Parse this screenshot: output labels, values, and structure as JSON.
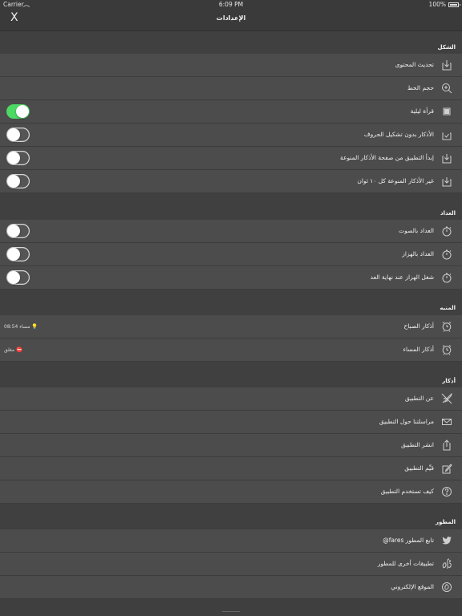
{
  "status": {
    "carrier": "Carrier",
    "time": "6:09 PM",
    "battery": "100%"
  },
  "nav": {
    "close": "X",
    "title": "الإعدادات"
  },
  "sections": {
    "shape": {
      "header": "الشكل",
      "update_content": "تحديث المحتوى",
      "font_size": "حجم الخط",
      "night_reading": "قرأة ليلية",
      "no_diacritics": "الأذكار بدون تشكيل الحروف",
      "start_varied": "إبدأ التطبيق من صفحة الأذكار المنوعة",
      "change_colors": "غير الأذكار المنوعة كل ١٠ ثوان"
    },
    "counter": {
      "header": "العداد",
      "sound": "العداد بالصوت",
      "vibration": "العداد بالهزاز",
      "vibrate_end": "شغل الهزاز عند نهاية العد"
    },
    "alarm": {
      "header": "المنبه",
      "morning": "أذكار الصباح",
      "morning_info": "08:54 مساء",
      "evening": "أذكار المساء",
      "evening_info": "مغلق"
    },
    "azkar": {
      "header": "أذكار",
      "about": "عن التطبيق",
      "contact": "مراسلتنا حول التطبيق",
      "share": "انشر التطبيق",
      "rate": "قيِّم التطبيق",
      "howto": "كيف تستخدم التطبيق"
    },
    "developer": {
      "header": "المطور",
      "follow": "تابع المطور fares@",
      "other_apps": "تطبيقات أخرى للمطور",
      "website": "الموقع الإلكتروني"
    }
  },
  "toggles": {
    "night_reading": true,
    "no_diacritics": false,
    "start_varied": false,
    "change_colors": false,
    "counter_sound": false,
    "counter_vibration": false,
    "vibrate_end": false
  },
  "colors": {
    "toggle_on": "#4cd964",
    "background": "#3f3f3f",
    "row": "#4c4c4c"
  },
  "icons": {
    "update_content": "download-icon",
    "font_size": "magnifier-plus-icon",
    "night_reading": "square-icon",
    "no_diacritics": "checkbox-icon",
    "start_varied": "download-icon",
    "change_colors": "download-icon",
    "counter": "stopwatch-icon",
    "alarm": "alarm-clock-icon",
    "about": "rocket-icon",
    "contact": "envelope-icon",
    "share": "share-icon",
    "rate": "pencil-icon",
    "howto": "question-icon",
    "follow": "twitter-icon",
    "other_apps": "developer-logo-icon",
    "website": "globe-icon"
  }
}
